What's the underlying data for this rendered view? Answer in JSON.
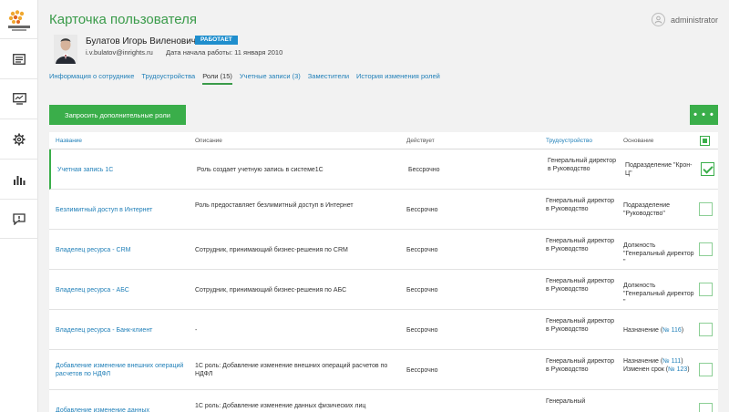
{
  "window": {
    "title": "Карточка пользователя"
  },
  "sidebar": {
    "items": [
      {
        "icon": "list-icon"
      },
      {
        "icon": "monitor-icon"
      },
      {
        "icon": "gear-icon"
      },
      {
        "icon": "chart-icon"
      },
      {
        "icon": "message-alert-icon"
      }
    ]
  },
  "user": {
    "name": "administrator",
    "icon": "user-avatar-icon"
  },
  "employee": {
    "name": "Булатов Игорь Виленович",
    "status": "РАБОТАЕТ",
    "email": "i.v.bulatov@inrights.ru",
    "start_date": "Дата начала работы: 11 января 2010"
  },
  "tabs": [
    {
      "label": "Информация о сотруднике",
      "active": false
    },
    {
      "label": "Трудоустройства",
      "active": false
    },
    {
      "label": "Роли (15)",
      "active": true
    },
    {
      "label": "Учетные записи (3)",
      "active": false
    },
    {
      "label": "Заместители",
      "active": false
    },
    {
      "label": "История изменения ролей",
      "active": false
    }
  ],
  "toolbar": {
    "request_roles_label": "Запросить дополнительные роли",
    "more_label": "• • •"
  },
  "table": {
    "headers": {
      "name": "Название",
      "description": "Описание",
      "active": "Действует",
      "employment": "Трудоустройство",
      "basis": "Основание"
    },
    "rows": [
      {
        "name": "Учетная запись 1С",
        "description": "Роль создает учетную запись в системе1С",
        "active": "Бессрочно",
        "employment": "Генеральный директор в Руководство",
        "basis": [
          {
            "text": "Подразделение \"Крон-Ц\""
          }
        ],
        "checked": true
      },
      {
        "name": "Безлимитный доступ в Интернет",
        "description": "Роль предоставляет безлимитный доступ в Интернет",
        "active": "Бессрочно",
        "employment": "Генеральный директор в Руководство",
        "basis": [
          {
            "text": "Подразделение \"Руководство\""
          }
        ],
        "checked": false
      },
      {
        "name": "Владелец ресурса - CRM",
        "description": "Сотрудник, принимающий бизнес-решения по CRM",
        "active": "Бессрочно",
        "employment": "Генеральный директор в Руководство",
        "basis": [
          {
            "text": "Должность \"Генеральный директор \""
          }
        ],
        "checked": false
      },
      {
        "name": "Владелец ресурса - АБС",
        "description": "Сотрудник, принимающий бизнес-решения по АБС",
        "active": "Бессрочно",
        "employment": "Генеральный директор в Руководство",
        "basis": [
          {
            "text": "Должность \"Генеральный директор \""
          }
        ],
        "checked": false
      },
      {
        "name": "Владелец ресурса - Банк-клиент",
        "description": "-",
        "active": "Бессрочно",
        "employment": "Генеральный директор в Руководство",
        "basis": [
          {
            "text": "Назначение (",
            "link": "№ 116",
            "after": ")"
          }
        ],
        "checked": false
      },
      {
        "name": "Добавление изменение внешних операций расчетов по НДФЛ",
        "description": "1С роль: Добавление изменение внешних операций расчетов по НДФЛ",
        "active": "Бессрочно",
        "employment": "Генеральный директор в Руководство",
        "basis": [
          {
            "text": "Назначение (",
            "link": "№ 111",
            "after": ")"
          },
          {
            "text": "Изменен срок (",
            "link": "№ 123",
            "after": ")"
          }
        ],
        "checked": false
      },
      {
        "name": "Добавление изменение данных",
        "description": "1С роль: Добавление изменение данных физических лиц",
        "active": "",
        "employment": "Генеральный",
        "basis": [],
        "checked": false
      }
    ]
  }
}
